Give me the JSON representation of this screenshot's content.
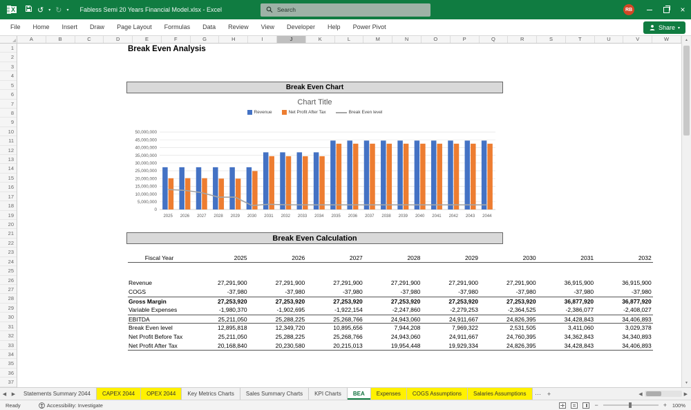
{
  "colors": {
    "accent_green": "#107C41",
    "tab_yellow": "#FFF100",
    "bar_blue": "#4472C4",
    "bar_orange": "#ED7D31",
    "line_gray": "#A5A5A5"
  },
  "title_bar": {
    "title": "Fabless Semi 20 Years Financial Model.xlsx  -  Excel",
    "search_placeholder": "Search",
    "avatar_initials": "RB"
  },
  "ribbon": {
    "tabs": [
      "File",
      "Home",
      "Insert",
      "Draw",
      "Page Layout",
      "Formulas",
      "Data",
      "Review",
      "View",
      "Developer",
      "Help",
      "Power Pivot"
    ],
    "share_label": "Share"
  },
  "grid": {
    "columns": [
      "A",
      "B",
      "C",
      "D",
      "E",
      "F",
      "G",
      "H",
      "I",
      "J",
      "K",
      "L",
      "M",
      "N",
      "O",
      "P",
      "Q",
      "R",
      "S",
      "T",
      "U",
      "V",
      "W"
    ],
    "selected_column": "J",
    "row_count": 37,
    "page_title": "Break Even Analysis"
  },
  "chart_section": {
    "header": "Break Even Chart"
  },
  "chart_data": {
    "type": "bar",
    "title": "Chart Title",
    "categories": [
      "2025",
      "2026",
      "2027",
      "2028",
      "2029",
      "2030",
      "2031",
      "2032",
      "2033",
      "2034",
      "2035",
      "2036",
      "2037",
      "2038",
      "2039",
      "2040",
      "2041",
      "2042",
      "2043",
      "2044"
    ],
    "series": [
      {
        "name": "Revenue",
        "type": "bar",
        "color": "#4472C4",
        "values": [
          27291900,
          27291900,
          27291900,
          27291900,
          27291900,
          27291900,
          36915900,
          36915900,
          36915900,
          36915900,
          44500000,
          44500000,
          44500000,
          44500000,
          44500000,
          44500000,
          44500000,
          44500000,
          44500000,
          44500000
        ]
      },
      {
        "name": "Net Profit After Tax",
        "type": "bar",
        "color": "#ED7D31",
        "values": [
          20168840,
          20230580,
          20215013,
          19954448,
          19929334,
          24826395,
          34428843,
          34406893,
          34400000,
          34400000,
          42500000,
          42500000,
          42500000,
          42500000,
          42500000,
          42500000,
          42500000,
          42500000,
          42500000,
          42500000
        ]
      },
      {
        "name": "Break Even level",
        "type": "line",
        "color": "#A5A5A5",
        "values": [
          12895818,
          12349720,
          10895656,
          7944208,
          7969322,
          2531505,
          3411060,
          3029378,
          3000000,
          3000000,
          3000000,
          3000000,
          3000000,
          3000000,
          3000000,
          3000000,
          3000000,
          3000000,
          3000000,
          3000000
        ]
      }
    ],
    "ylim": [
      0,
      50000000
    ],
    "ytick_step": 5000000,
    "legend_position": "top",
    "grid": true
  },
  "calc_section": {
    "header": "Break Even Calculation",
    "fiscal_year_label": "Fiscal Year",
    "years": [
      "2025",
      "2026",
      "2027",
      "2028",
      "2029",
      "2030",
      "2031",
      "2032"
    ],
    "rows": [
      {
        "label": "Revenue",
        "bold": false,
        "border_top": false,
        "border_bottom": false,
        "values": [
          "27,291,900",
          "27,291,900",
          "27,291,900",
          "27,291,900",
          "27,291,900",
          "27,291,900",
          "36,915,900",
          "36,915,900"
        ]
      },
      {
        "label": "COGS",
        "bold": false,
        "border_top": false,
        "border_bottom": false,
        "values": [
          "-37,980",
          "-37,980",
          "-37,980",
          "-37,980",
          "-37,980",
          "-37,980",
          "-37,980",
          "-37,980"
        ]
      },
      {
        "label": "Gross Margin",
        "bold": true,
        "border_top": true,
        "border_bottom": false,
        "values": [
          "27,253,920",
          "27,253,920",
          "27,253,920",
          "27,253,920",
          "27,253,920",
          "27,253,920",
          "36,877,920",
          "36,877,920"
        ]
      },
      {
        "label": "Variable Expenses",
        "bold": false,
        "border_top": false,
        "border_bottom": false,
        "values": [
          "-1,980,370",
          "-1,902,695",
          "-1,922,154",
          "-2,247,860",
          "-2,279,253",
          "-2,364,525",
          "-2,386,077",
          "-2,408,027"
        ]
      },
      {
        "label": "EBITDA",
        "bold": false,
        "border_top": true,
        "border_bottom": true,
        "values": [
          "25,211,050",
          "25,288,225",
          "25,268,766",
          "24,943,060",
          "24,911,667",
          "24,826,395",
          "34,428,843",
          "34,406,893"
        ]
      },
      {
        "label": "Break Even level",
        "bold": false,
        "border_top": false,
        "border_bottom": false,
        "values": [
          "12,895,818",
          "12,349,720",
          "10,895,656",
          "7,944,208",
          "7,969,322",
          "2,531,505",
          "3,411,060",
          "3,029,378"
        ]
      },
      {
        "label": "Net Profit Before Tax",
        "bold": false,
        "border_top": false,
        "border_bottom": false,
        "values": [
          "25,211,050",
          "25,288,225",
          "25,268,766",
          "24,943,060",
          "24,911,667",
          "24,760,395",
          "34,362,843",
          "34,340,893"
        ]
      },
      {
        "label": "Net Profit After Tax",
        "bold": false,
        "border_top": false,
        "border_bottom": true,
        "values": [
          "20,168,840",
          "20,230,580",
          "20,215,013",
          "19,954,448",
          "19,929,334",
          "24,826,395",
          "34,428,843",
          "34,406,893"
        ]
      }
    ]
  },
  "sheet_tabs": {
    "tabs": [
      {
        "label": "Statements Summary 2044",
        "style": "normal"
      },
      {
        "label": "CAPEX 2044",
        "style": "yellow"
      },
      {
        "label": "OPEX 2044",
        "style": "yellow"
      },
      {
        "label": "Key Metrics Charts",
        "style": "normal"
      },
      {
        "label": "Sales Summary Charts",
        "style": "normal"
      },
      {
        "label": "KPI Charts",
        "style": "normal"
      },
      {
        "label": "BEA",
        "style": "active"
      },
      {
        "label": "Expenses",
        "style": "yellow"
      },
      {
        "label": "COGS Assumptions",
        "style": "yellow"
      },
      {
        "label": "Salaries Assumptions",
        "style": "yellow"
      }
    ]
  },
  "status_bar": {
    "ready": "Ready",
    "accessibility": "Accessibility: Investigate",
    "zoom": "100%"
  }
}
